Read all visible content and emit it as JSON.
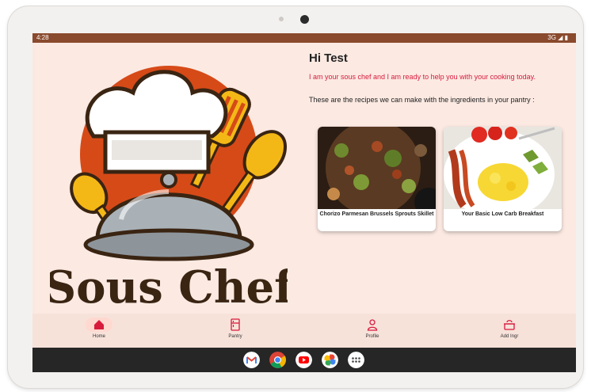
{
  "status_bar": {
    "time": "4:28",
    "signal": "3G"
  },
  "logo": {
    "text": "Sous Chef"
  },
  "header": {
    "greeting": "Hi Test",
    "intro": "I am your sous chef and I am ready to help you with your cooking today.",
    "pantry_text": "These are the recipes we can make with the ingredients in your pantry :"
  },
  "recipes": [
    {
      "title": "Chorizo Parmesan Brussels Sprouts Skillet"
    },
    {
      "title": "Your Basic Low Carb Breakfast"
    }
  ],
  "nav": [
    {
      "label": "Home",
      "icon": "home-icon"
    },
    {
      "label": "Pantry",
      "icon": "fridge-icon"
    },
    {
      "label": "Profile",
      "icon": "person-icon"
    },
    {
      "label": "Add Ingr",
      "icon": "cooking-pot-icon"
    }
  ],
  "dock": [
    "gmail",
    "chrome",
    "youtube",
    "photos",
    "app-drawer"
  ],
  "colors": {
    "accent": "#d81b3c",
    "status_bar": "#8a4a2d",
    "background": "#fbe9e2",
    "nav_bar": "#f7e2da"
  }
}
